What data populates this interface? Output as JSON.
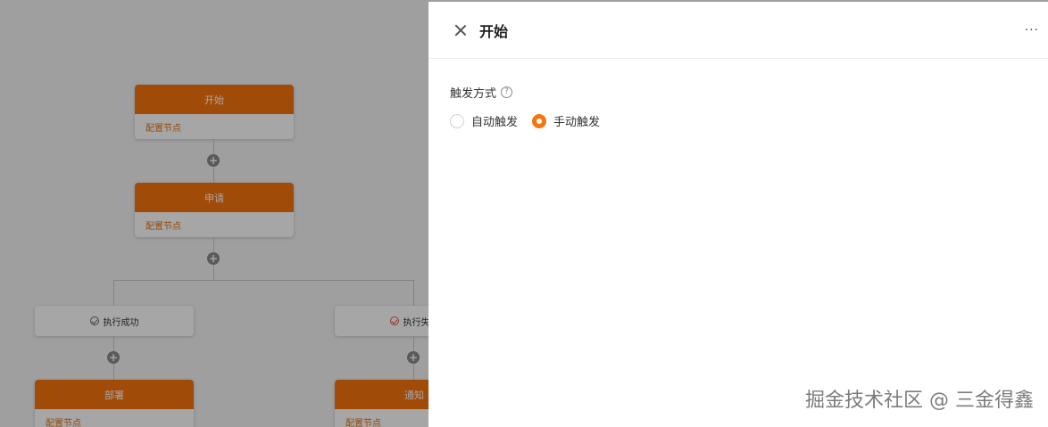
{
  "canvas": {
    "nodes": [
      {
        "title": "开始",
        "body": "配置节点"
      },
      {
        "title": "申请",
        "body": "配置节点"
      },
      {
        "title": "部署",
        "body": "配置节点"
      },
      {
        "title": "通知",
        "body": "配置节点"
      }
    ],
    "branches": [
      {
        "label": "执行成功",
        "status": "success"
      },
      {
        "label": "执行失败",
        "status": "fail"
      }
    ],
    "add_glyph": "+"
  },
  "drawer": {
    "title": "开始",
    "more_glyph": "···",
    "field": {
      "label": "触发方式",
      "help_glyph": "?",
      "options": [
        {
          "label": "自动触发",
          "checked": false
        },
        {
          "label": "手动触发",
          "checked": true
        }
      ]
    }
  },
  "watermark": "掘金技术社区 @ 三金得鑫",
  "colors": {
    "accent": "#f7740f",
    "canvas_bg": "#f4f4f5"
  }
}
